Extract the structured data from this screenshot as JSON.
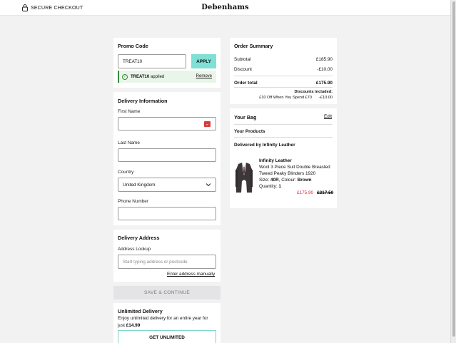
{
  "header": {
    "secure_label": "SECURE CHECKOUT",
    "brand": "Debenhams"
  },
  "promo": {
    "title": "Promo Code",
    "code_value": "TREAT10",
    "apply_label": "APPLY",
    "applied_code": "TREAT10",
    "applied_suffix": "applied",
    "remove_label": "Remove"
  },
  "delivery_info": {
    "title": "Delivery Information",
    "first_name_label": "First Name",
    "first_name_value": "",
    "last_name_label": "Last Name",
    "last_name_value": "",
    "country_label": "Country",
    "country_value": "United Kingdom",
    "phone_label": "Phone Number",
    "phone_value": ""
  },
  "delivery_address": {
    "title": "Delivery Address",
    "lookup_label": "Address Lookup",
    "lookup_placeholder": "Start typing address or postcode",
    "manual_link": "Enter address manually"
  },
  "continue_label": "SAVE & CONTINUE",
  "unlimited": {
    "title": "Unlimited Delivery",
    "desc_line1": "Enjoy unlimited delivery for an entire year for",
    "desc_prefix": "just",
    "price": "£14.99",
    "button_label": "GET UNLIMITED"
  },
  "order_summary": {
    "title": "Order Summary",
    "subtotal_label": "Subtotal",
    "subtotal_value": "£185.90",
    "discount_label": "Discount",
    "discount_value": "-£10.00",
    "total_label": "Order total",
    "total_value": "£175.90",
    "discounts_included_label": "Discounts included:",
    "discount_detail_label": "£10 Off When You Spend £70",
    "discount_detail_value": "-£10.00"
  },
  "bag": {
    "title": "Your Bag",
    "edit_label": "Edit",
    "products_label": "Your Products",
    "delivered_by": "Delivered by Infinity Leather",
    "product": {
      "brand": "Infinity Leather",
      "name_line1": "Wool 3 Piece Suit Double Breasted",
      "name_line2": "Tweed Peaky Blinders 1920",
      "size_label": "Size:",
      "size_value": "40R",
      "colour_label": "Colour:",
      "colour_value": "Brown",
      "quantity_label": "Quantity:",
      "quantity_value": "1",
      "price_now": "£175.90",
      "price_was": "£217.50"
    }
  },
  "colors": {
    "accent": "#7fe0d5",
    "sale": "#d0303a",
    "success": "#3a8a3a"
  }
}
